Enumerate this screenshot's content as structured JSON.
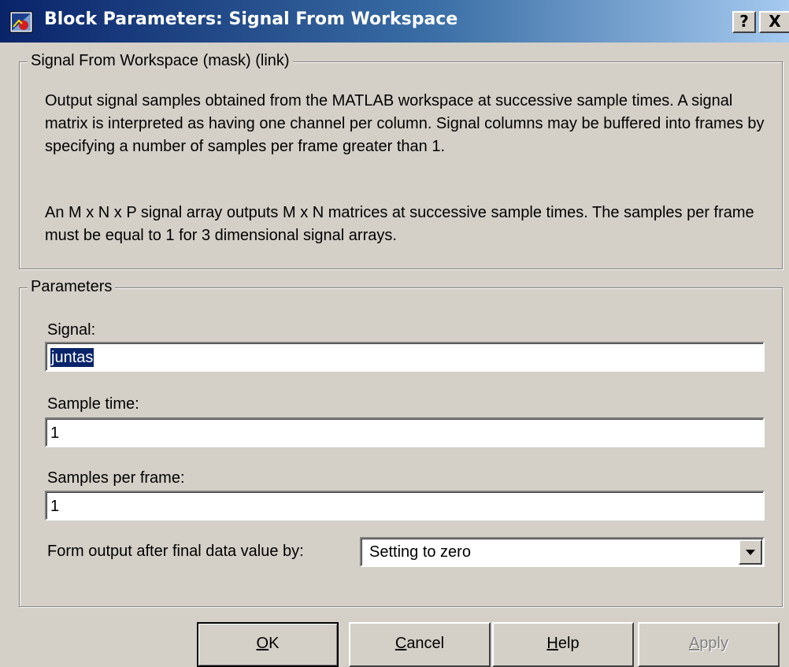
{
  "window": {
    "title": "Block Parameters: Signal From Workspace",
    "help_glyph": "?",
    "close_glyph": "X"
  },
  "description": {
    "group_title": "Signal From Workspace (mask) (link)",
    "paragraph1": "Output signal samples obtained from the MATLAB workspace at successive sample times.  A signal matrix is interpreted as having one channel per column.  Signal columns may be buffered into frames by specifying a number of samples per frame greater than 1.",
    "paragraph2": "An M x N x P signal array outputs M x N matrices at successive sample times.  The samples per frame must be equal to 1 for 3 dimensional signal arrays."
  },
  "parameters": {
    "group_title": "Parameters",
    "signal_label": "Signal:",
    "signal_value": "juntas",
    "sample_time_label": "Sample time:",
    "sample_time_value": "1",
    "samples_per_frame_label": "Samples per frame:",
    "samples_per_frame_value": "1",
    "form_output_label": "Form output after final data value by:",
    "form_output_value": "Setting to zero"
  },
  "buttons": {
    "ok_mnemonic": "O",
    "ok_rest": "K",
    "cancel_mnemonic": "C",
    "cancel_rest": "ancel",
    "help_mnemonic": "H",
    "help_rest": "elp",
    "apply_mnemonic": "A",
    "apply_rest": "pply"
  },
  "colors": {
    "face": "#d4d0c8",
    "title_active": "#0a246a",
    "selection": "#0a246a",
    "disabled_text": "#808080"
  }
}
